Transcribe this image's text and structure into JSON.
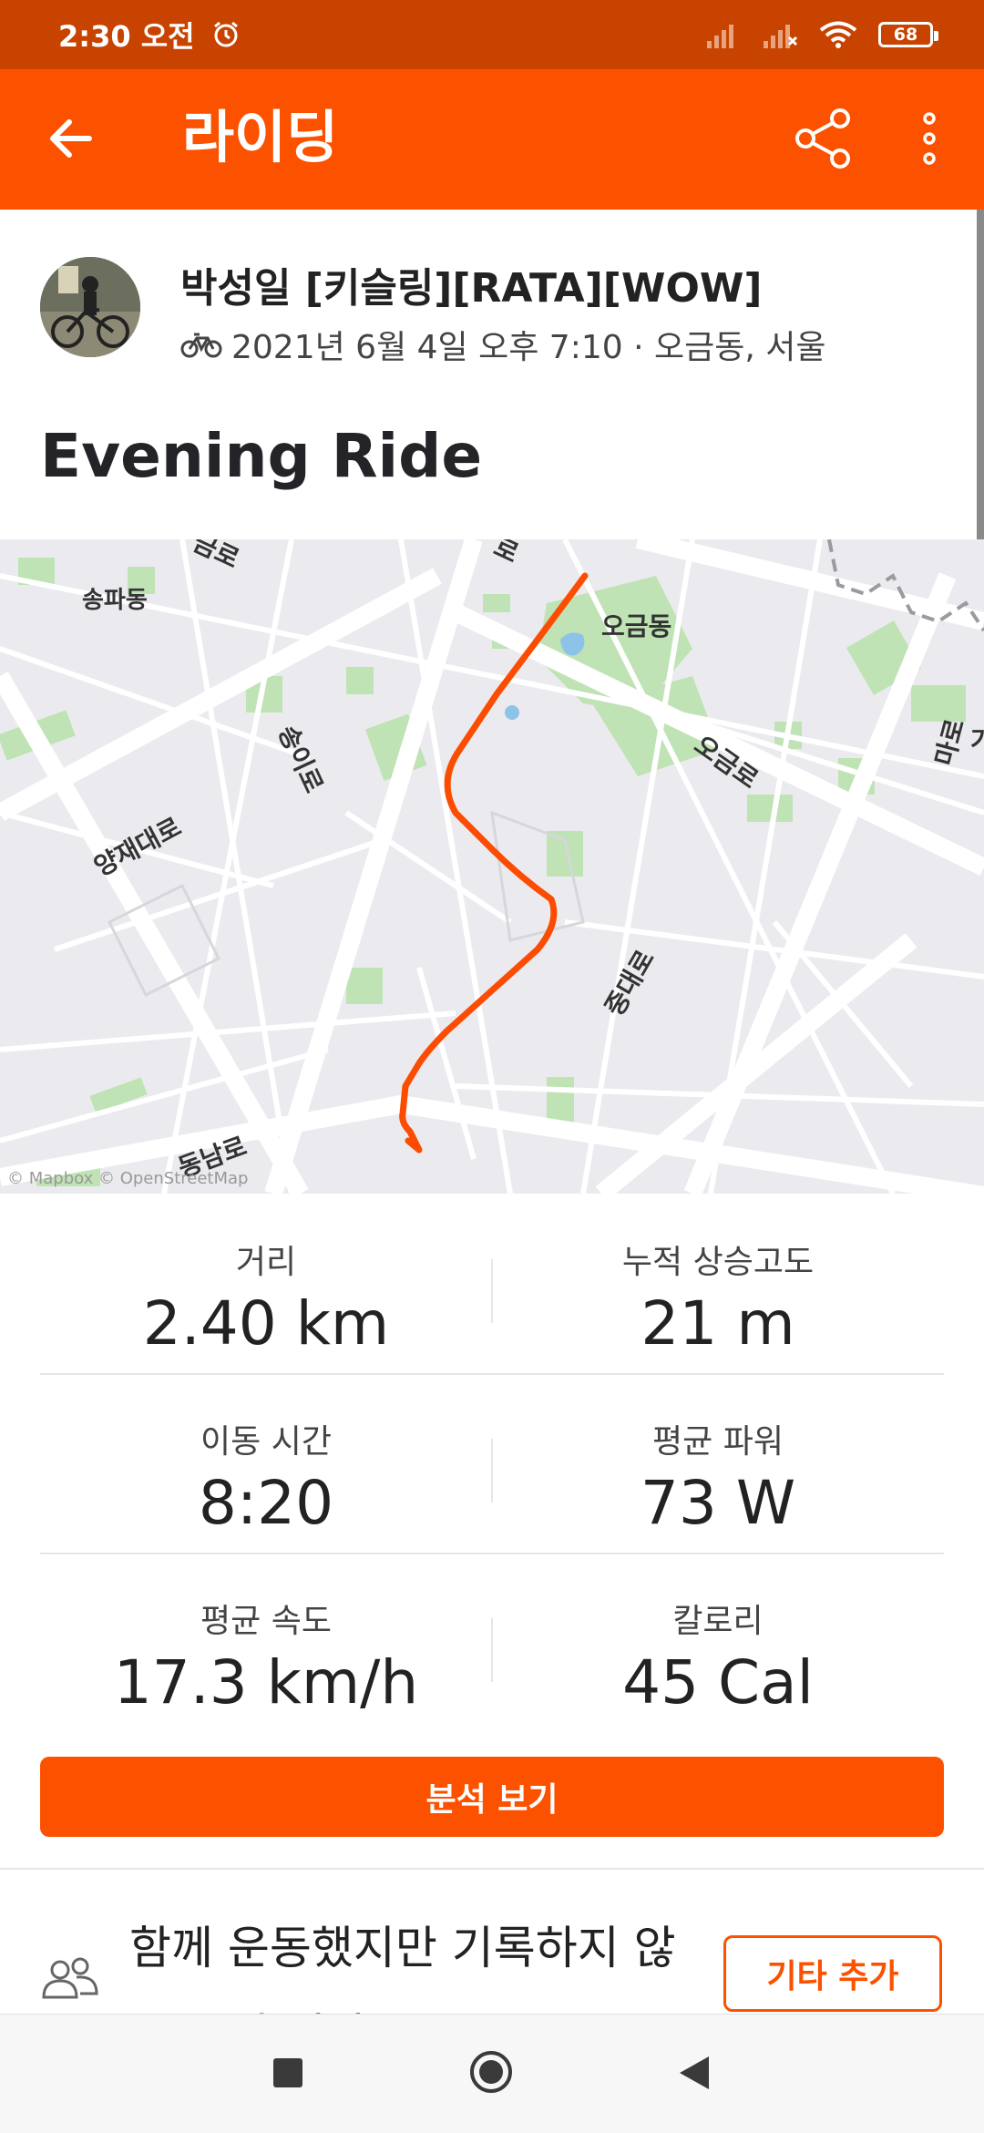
{
  "status_bar": {
    "time": "2:30 오전",
    "battery": "68"
  },
  "app_bar": {
    "title": "라이딩"
  },
  "athlete": {
    "name": "박성일 [키슬링][RATA][WOW]",
    "activity_meta": "2021년 6월 4일 오후 7:10 · 오금동, 서울",
    "activity_icon": "bike-icon"
  },
  "activity": {
    "title": "Evening Ride"
  },
  "map": {
    "labels": {
      "songpa": "송파동",
      "ogeum": "오금동",
      "yangjae": "양재대로",
      "songi": "송이로",
      "ogeumro": "오금로",
      "top": "로",
      "top2": "금로",
      "bottom": "동남로",
      "right": "마로",
      "right2": "가",
      "center": "중대로"
    },
    "attribution": "© Mapbox © OpenStreetMap",
    "route_color": "#fc5200"
  },
  "stats": [
    {
      "label": "거리",
      "value": "2.40 km"
    },
    {
      "label": "누적 상승고도",
      "value": "21 m"
    },
    {
      "label": "이동 시간",
      "value": "8:20"
    },
    {
      "label": "평균 파워",
      "value": "73 W"
    },
    {
      "label": "평균 속도",
      "value": "17.3 km/h"
    },
    {
      "label": "칼로리",
      "value": "45 Cal"
    }
  ],
  "buttons": {
    "analyze": "분석 보기",
    "add_other": "기타 추가"
  },
  "together": {
    "text": "함께 운동했지만 기록하지 않은 분이 있나요?"
  },
  "colors": {
    "brand": "#fc5200",
    "status_bar": "#c84300"
  }
}
